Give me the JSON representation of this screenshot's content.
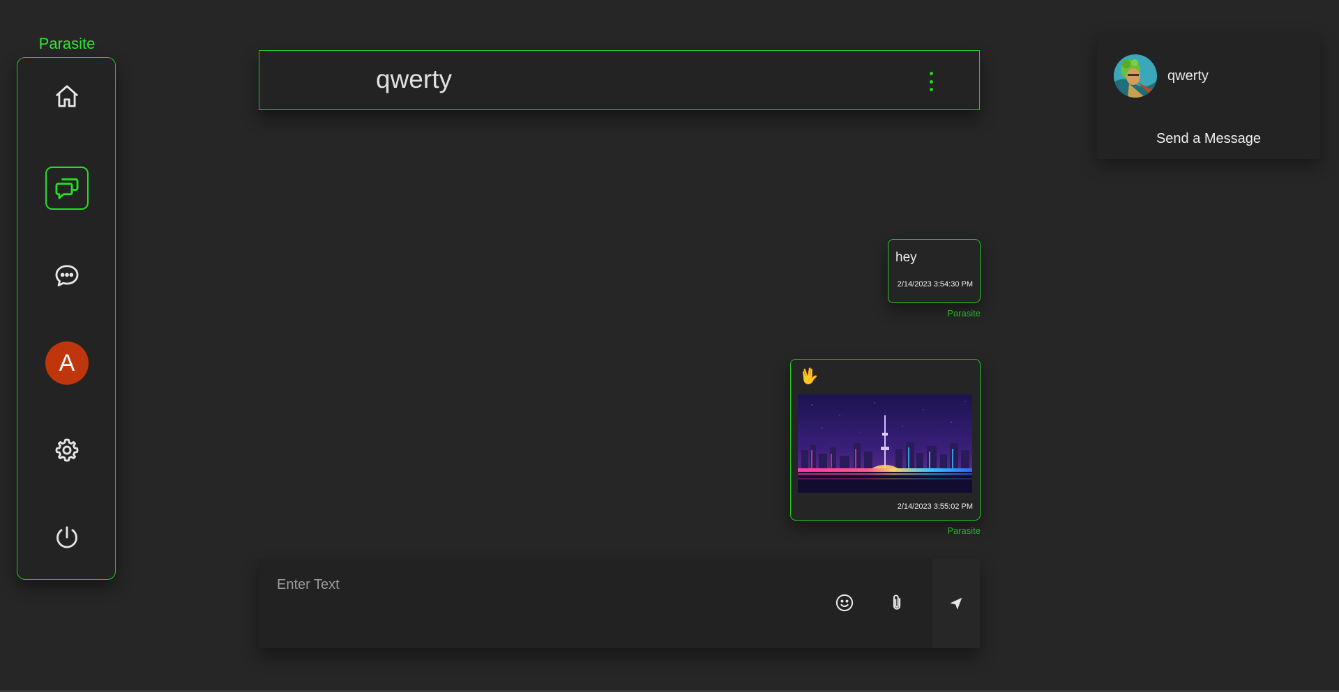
{
  "app": {
    "title": "Parasite"
  },
  "sidebar": {
    "items": [
      {
        "name": "home",
        "icon": "home-icon",
        "active": false
      },
      {
        "name": "chats",
        "icon": "chats-icon",
        "active": true
      },
      {
        "name": "messages",
        "icon": "speech-bubble-icon",
        "active": false
      },
      {
        "name": "profile",
        "icon": "avatar",
        "label": "A",
        "active": false
      },
      {
        "name": "settings",
        "icon": "gear-icon",
        "active": false
      },
      {
        "name": "logout",
        "icon": "power-icon",
        "active": false
      }
    ]
  },
  "chat": {
    "title": "qwerty",
    "messages": [
      {
        "text": "hey",
        "time": "2/14/2023 3:54:30 PM",
        "sender": "Parasite"
      },
      {
        "emoji": "🖖",
        "has_image": true,
        "time": "2/14/2023 3:55:02 PM",
        "sender": "Parasite"
      }
    ]
  },
  "composer": {
    "placeholder": "Enter Text",
    "icons": [
      "smile-icon",
      "paperclip-icon",
      "send-icon"
    ]
  },
  "right_panel": {
    "name": "qwerty",
    "action": "Send a Message"
  },
  "colors": {
    "accent": "#22c922",
    "background": "#262626",
    "avatar_bg": "#c0360c"
  }
}
